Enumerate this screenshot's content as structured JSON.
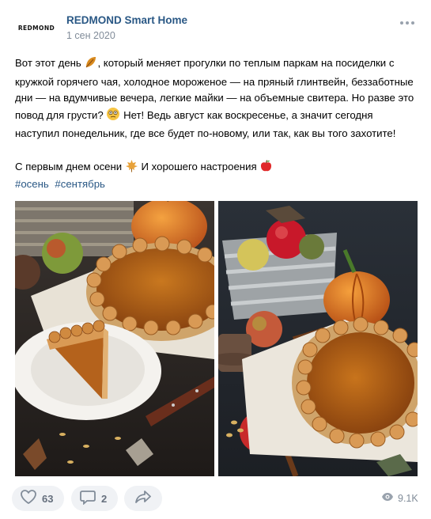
{
  "post": {
    "author": "REDMOND Smart Home",
    "date": "1 сен 2020",
    "logo_text": "REDMOND",
    "text": {
      "line1_a": "Вот этот день",
      "line1_b": ", который меняет прогулки по теплым паркам на посиделки с кружкой горячего чая, холодное мороженое — на пряный глинтвейн, беззаботные дни — на вдумчивые вечера, легкие майки — на объемные свитера. Но разве это повод для грусти?",
      "line1_c": "Нет! Ведь август как воскресенье, а значит сегодня наступил понедельник, где все будет по-новому, или так, как вы того захотите!",
      "line2_a": "С первым днем осени",
      "line2_b": "И хорошего настроения"
    },
    "hashtags": [
      "#осень",
      "#сентябрь"
    ]
  },
  "footer": {
    "likes": "63",
    "comments": "2",
    "views": "9.1K"
  },
  "colors": {
    "link": "#2a5885",
    "muted": "#818c99",
    "button_bg": "#f0f2f5",
    "icon": "#99a2ad"
  },
  "icons": [
    "more-icon",
    "leaf-icon",
    "smile-icon",
    "maple-leaf-icon",
    "apple-icon",
    "heart-icon",
    "comment-icon",
    "share-icon",
    "eye-icon"
  ]
}
